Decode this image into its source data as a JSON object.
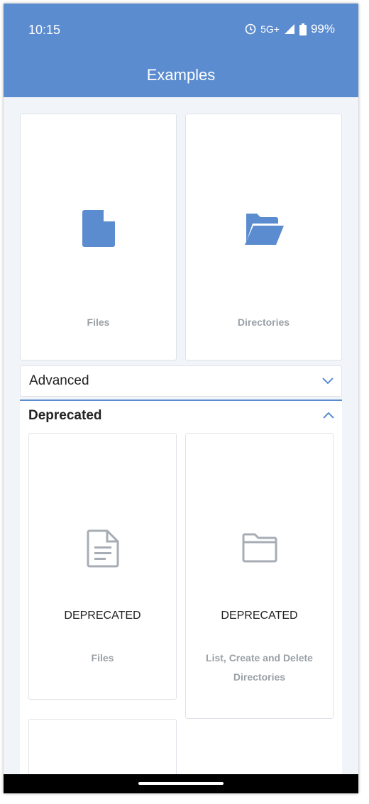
{
  "status_bar": {
    "time": "10:15",
    "network": "5G+",
    "battery": "99%"
  },
  "app_bar": {
    "title": "Examples"
  },
  "top_cards": [
    {
      "label": "Files",
      "icon": "file-icon"
    },
    {
      "label": "Directories",
      "icon": "folder-open-icon"
    }
  ],
  "advanced": {
    "label": "Advanced",
    "expanded": false
  },
  "deprecated": {
    "label": "Deprecated",
    "expanded": true,
    "cards": [
      {
        "badge": "DEPRECATED",
        "label": "Files",
        "icon": "document-outline-icon"
      },
      {
        "badge": "DEPRECATED",
        "label": "List, Create and Delete Directories",
        "icon": "folder-outline-icon"
      }
    ]
  },
  "colors": {
    "primary": "#5b8ccf",
    "background": "#f1f4f8",
    "muted_text": "#9aa0a6"
  }
}
